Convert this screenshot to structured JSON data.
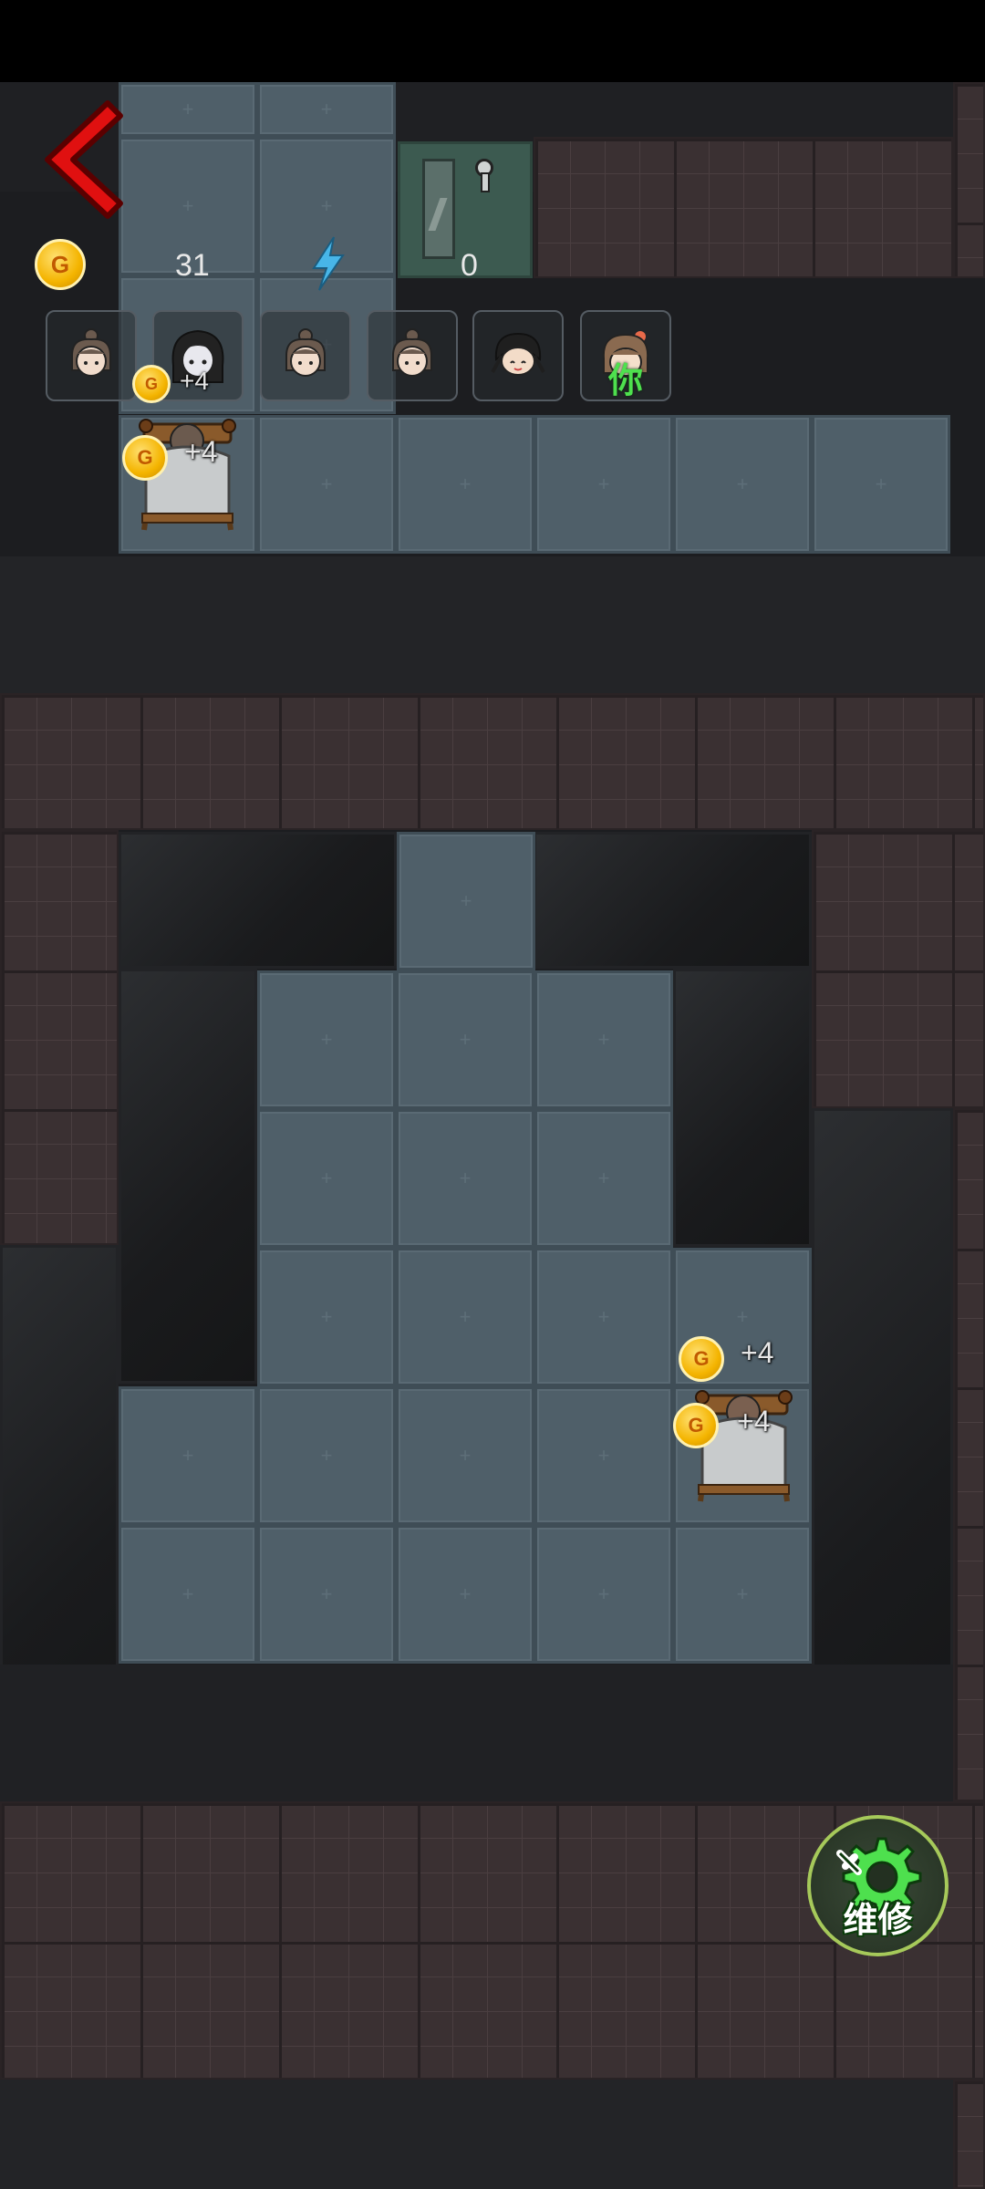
{
  "hud": {
    "coins": "31",
    "energy": "0",
    "coin_symbol": "G"
  },
  "roster": [
    {
      "name": "girl-bun-1",
      "badge": ""
    },
    {
      "name": "girl-longhair",
      "badge": "+4"
    },
    {
      "name": "girl-bun-2",
      "badge": ""
    },
    {
      "name": "girl-bun-3",
      "badge": ""
    },
    {
      "name": "boy-darkhair",
      "badge": ""
    },
    {
      "name": "player",
      "badge": "你"
    }
  ],
  "beds": [
    {
      "gain_top": "+4",
      "gain_bottom": "+4"
    },
    {
      "gain_top": "+4",
      "gain_bottom": "+4"
    }
  ],
  "repair_button": {
    "label": "维修"
  },
  "colors": {
    "floor": "#4f5f69",
    "wall": "#3a3032",
    "door": "#3c5a50",
    "accent_green": "#4ee04e",
    "back_arrow": "#e01010",
    "coin": "#f4b400",
    "energy": "#48b6e8"
  },
  "icons": {
    "back": "back-arrow-icon",
    "coin": "gold-coin-icon",
    "energy": "lightning-icon",
    "repair": "gear-wrench-icon"
  }
}
